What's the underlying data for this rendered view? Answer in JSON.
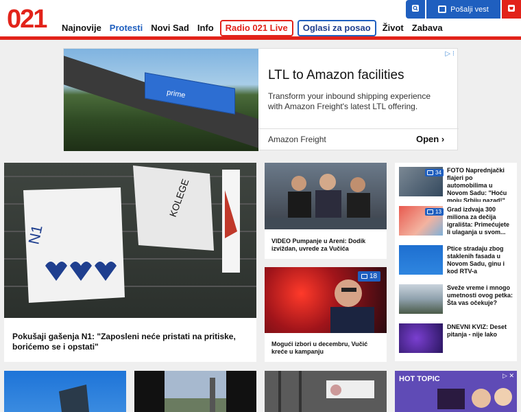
{
  "logo": {
    "text": "021"
  },
  "nav": {
    "items": [
      {
        "label": "Najnovije"
      },
      {
        "label": "Protesti"
      },
      {
        "label": "Novi Sad"
      },
      {
        "label": "Info"
      },
      {
        "label": "Radio 021 Live"
      },
      {
        "label": "Oglasi za posao"
      },
      {
        "label": "Život"
      },
      {
        "label": "Zabava"
      }
    ]
  },
  "top_buttons": {
    "send_label": "Pošalji vest"
  },
  "ad": {
    "title": "LTL to Amazon facilities",
    "description": "Transform your inbound shipping experience with Amazon Freight's latest LTL offering.",
    "brand": "Amazon Freight",
    "cta": "Open",
    "truck_text": "prime"
  },
  "articles": {
    "main": {
      "title": "Pokušaji gašenja N1: \"Zaposleni neće pristati na pritiske, borićemo se i opstati\""
    },
    "mid1": {
      "title": "VIDEO Pumpanje u Areni: Dodik izviždan, uvrede za Vučića"
    },
    "mid2": {
      "title": "Mogući izbori u decembru, Vučić kreće u kampanju",
      "comments": "18"
    }
  },
  "sidebar": {
    "items": [
      {
        "title": "FOTO Naprednjački flajeri po automobilima u Novom Sadu: \"Hoću moju Srbiju nazad!\"",
        "comments": "34"
      },
      {
        "title": "Grad izdvaja 300 miliona za dečija igrališta: Primećujete li ulaganja u svom...",
        "comments": "13"
      },
      {
        "title": "Ptice stradaju zbog staklenih fasada u Novom Sadu, ginu i kod RTV-a"
      },
      {
        "title": "Sveže vreme i mnogo umetnosti ovog petka: Šta vas očekuje?"
      },
      {
        "title": "DNEVNI KVIZ: Deset pitanja - nije lako"
      }
    ]
  },
  "bottom_ad": {
    "text": "HOT TOPIC"
  },
  "colors": {
    "brand_red": "#e2231a",
    "brand_blue": "#1f5fbf"
  }
}
